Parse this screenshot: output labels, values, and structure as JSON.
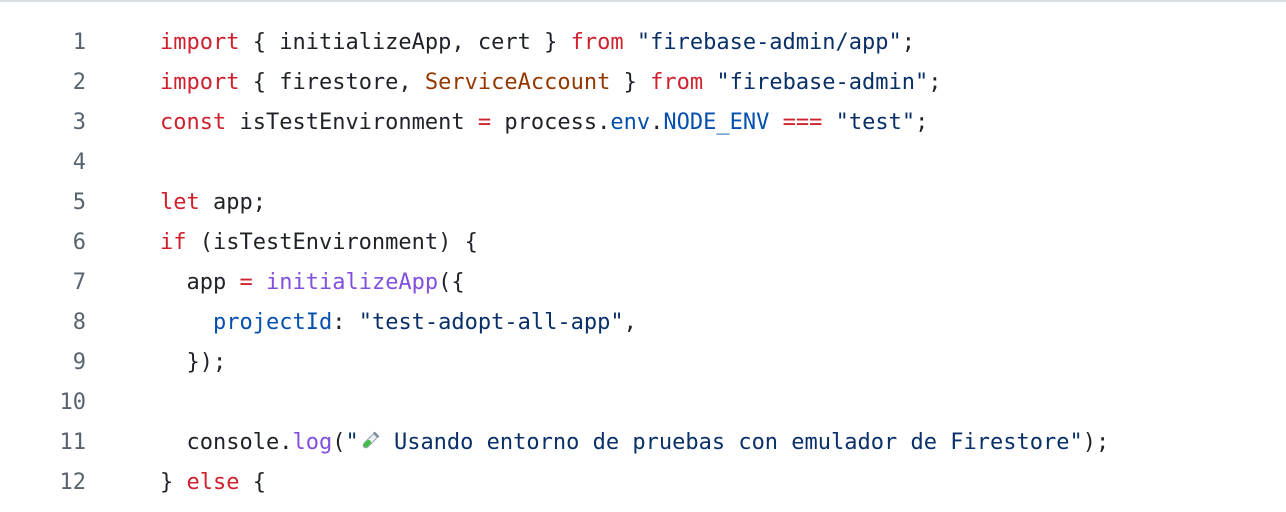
{
  "editor": {
    "icons": {
      "test-tube": "test-tube-icon"
    },
    "lines": [
      {
        "n": "1",
        "t": [
          {
            "k": "import"
          },
          {
            "p": " { initializeApp, cert } "
          },
          {
            "k": "from"
          },
          {
            "p": " "
          },
          {
            "s": "\"firebase-admin/app\""
          },
          {
            "p": ";"
          }
        ]
      },
      {
        "n": "2",
        "t": [
          {
            "k": "import"
          },
          {
            "p": " { firestore, "
          },
          {
            "t": "ServiceAccount"
          },
          {
            "p": " } "
          },
          {
            "k": "from"
          },
          {
            "p": " "
          },
          {
            "s": "\"firebase-admin\""
          },
          {
            "p": ";"
          }
        ]
      },
      {
        "n": "3",
        "t": [
          {
            "k": "const"
          },
          {
            "p": " isTestEnvironment "
          },
          {
            "k": "="
          },
          {
            "p": " process."
          },
          {
            "c": "env"
          },
          {
            "p": "."
          },
          {
            "c": "NODE_ENV"
          },
          {
            "p": " "
          },
          {
            "k": "==="
          },
          {
            "p": " "
          },
          {
            "s": "\"test\""
          },
          {
            "p": ";"
          }
        ]
      },
      {
        "n": "4",
        "t": []
      },
      {
        "n": "5",
        "t": [
          {
            "k": "let"
          },
          {
            "p": " app;"
          }
        ]
      },
      {
        "n": "6",
        "t": [
          {
            "k": "if"
          },
          {
            "p": " (isTestEnvironment) {"
          }
        ]
      },
      {
        "n": "7",
        "t": [
          {
            "p": "  app "
          },
          {
            "k": "="
          },
          {
            "p": " "
          },
          {
            "f": "initializeApp"
          },
          {
            "p": "({"
          }
        ]
      },
      {
        "n": "8",
        "t": [
          {
            "p": "    "
          },
          {
            "c": "projectId"
          },
          {
            "p": ": "
          },
          {
            "s": "\"test-adopt-all-app\""
          },
          {
            "p": ","
          }
        ]
      },
      {
        "n": "9",
        "t": [
          {
            "p": "  });"
          }
        ]
      },
      {
        "n": "10",
        "t": []
      },
      {
        "n": "11",
        "t": [
          {
            "p": "  console."
          },
          {
            "f": "log"
          },
          {
            "p": "("
          },
          {
            "s": "\""
          },
          {
            "icon": "test-tube"
          },
          {
            "s": " Usando entorno de pruebas con emulador de Firestore\""
          },
          {
            "p": ");"
          }
        ]
      },
      {
        "n": "12",
        "t": [
          {
            "p": "} "
          },
          {
            "k": "else"
          },
          {
            "p": " {"
          }
        ]
      }
    ]
  }
}
